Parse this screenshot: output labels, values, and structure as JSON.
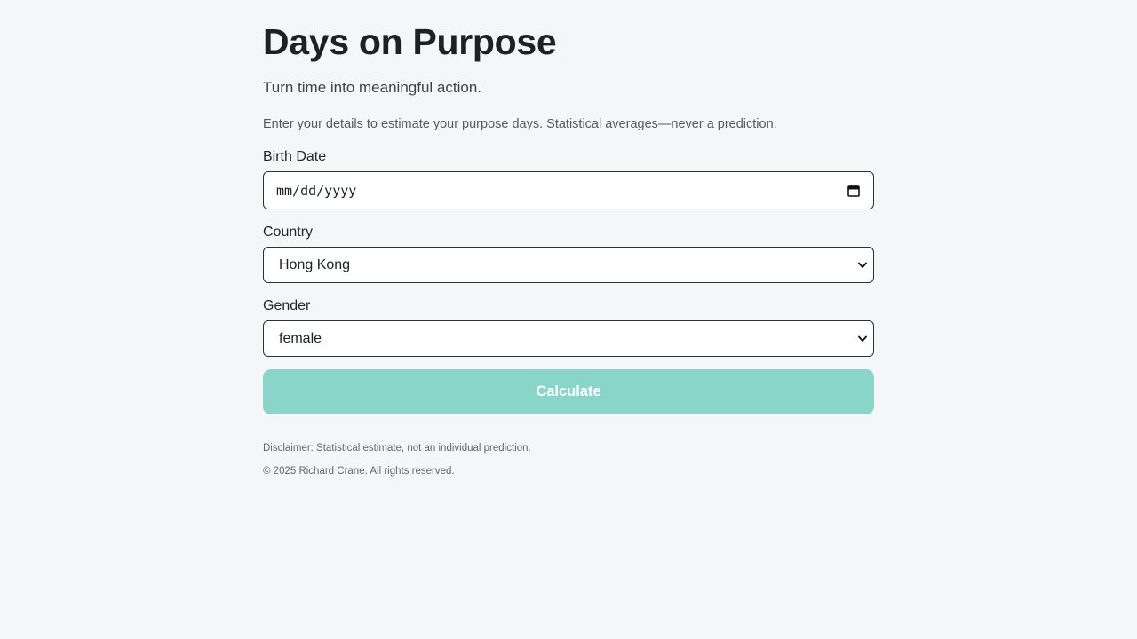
{
  "header": {
    "title": "Days on Purpose",
    "tagline": "Turn time into meaningful action.",
    "intro": "Enter your details to estimate your purpose days. Statistical averages—never a prediction."
  },
  "form": {
    "birth_date": {
      "label": "Birth Date",
      "placeholder": "mm/dd/yyyy",
      "icon": "calendar-icon"
    },
    "country": {
      "label": "Country",
      "selected": "Hong Kong",
      "icon": "chevron-down-icon"
    },
    "gender": {
      "label": "Gender",
      "selected": "female",
      "icon": "chevron-down-icon"
    },
    "submit_label": "Calculate"
  },
  "footer": {
    "disclaimer": "Disclaimer: Statistical estimate, not an individual prediction.",
    "copyright": "© 2025 Richard Crane. All rights reserved."
  },
  "colors": {
    "background": "#f4f6f8",
    "button": "#89d5ca",
    "text": "#1a2224"
  }
}
